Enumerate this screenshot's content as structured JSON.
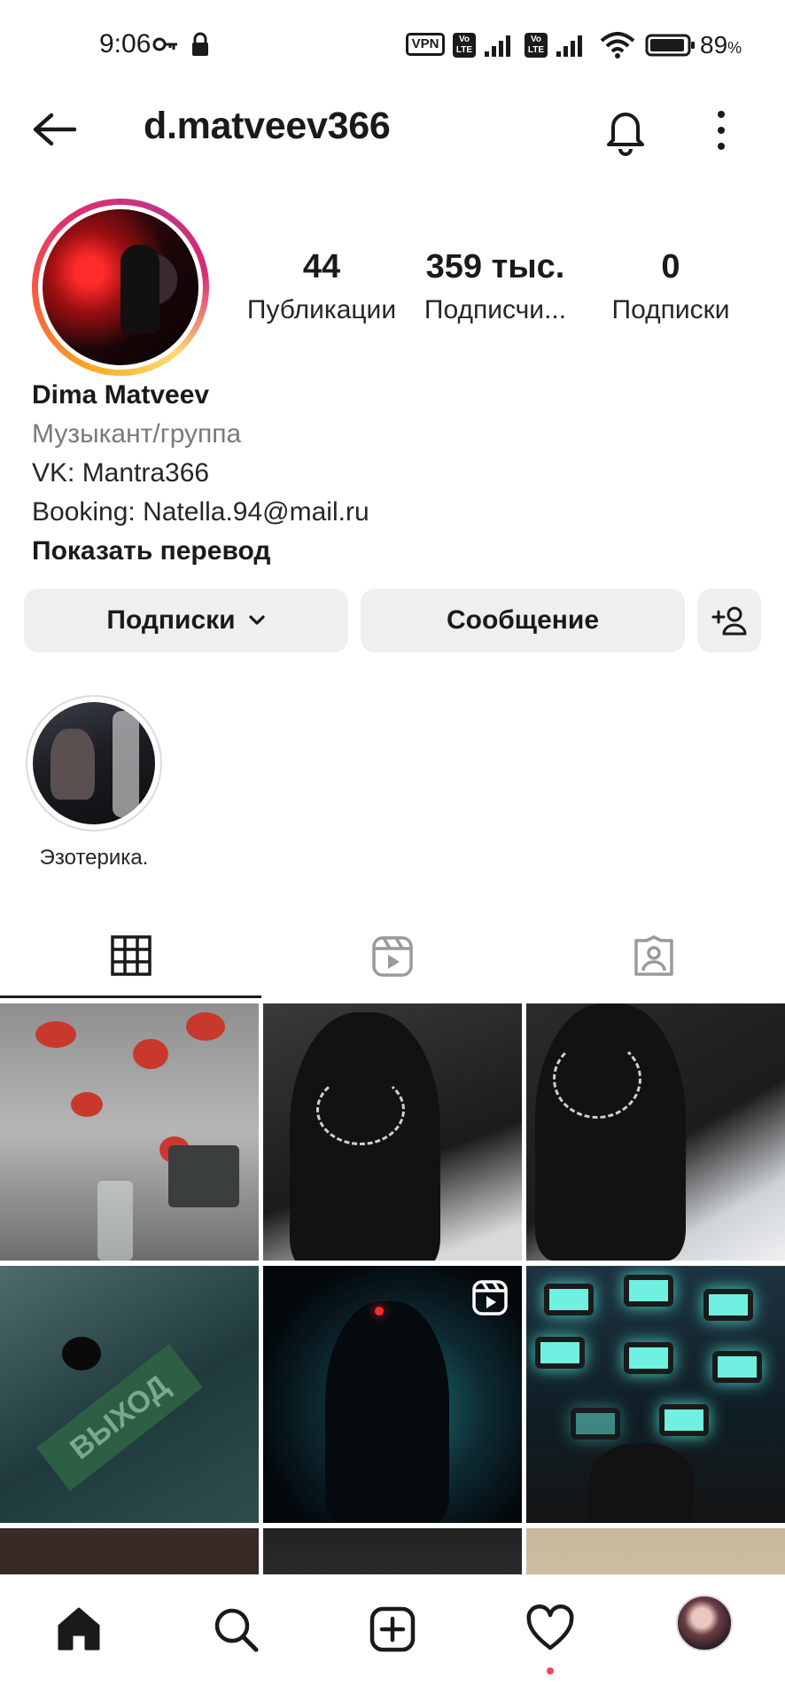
{
  "status_bar": {
    "time": "9:06",
    "vpn": "VPN",
    "volte": "Vo LTE",
    "battery": "89",
    "battery_unit": "%"
  },
  "header": {
    "username": "d.matveev366"
  },
  "profile": {
    "stats": [
      {
        "value": "44",
        "label": "Публикации"
      },
      {
        "value": "359 тыс.",
        "label": "Подписчи..."
      },
      {
        "value": "0",
        "label": "Подписки"
      }
    ],
    "name": "Dima Matveev",
    "category": "Музыкант/группа",
    "bio_lines": [
      "VK: Mantra366",
      "Booking: Natella.94@mail.ru"
    ],
    "translate_label": "Показать перевод"
  },
  "actions": {
    "following_label": "Подписки",
    "message_label": "Сообщение"
  },
  "highlights": [
    {
      "label": "Эзотерика."
    }
  ],
  "tabs": {
    "active": "grid",
    "items": [
      "grid-icon",
      "reels-icon",
      "tagged-icon"
    ]
  },
  "grid": {
    "exit_sign_text": "ВЫХОД"
  },
  "bottom_nav": {
    "items": [
      "home-icon",
      "search-icon",
      "create-icon",
      "activity-icon",
      "profile-avatar"
    ],
    "notification_dot_color": "#ed4956"
  },
  "colors": {
    "button_bg": "#efefef",
    "story_ring": [
      "#feda75",
      "#f56040",
      "#e1306c",
      "#c13584"
    ]
  }
}
